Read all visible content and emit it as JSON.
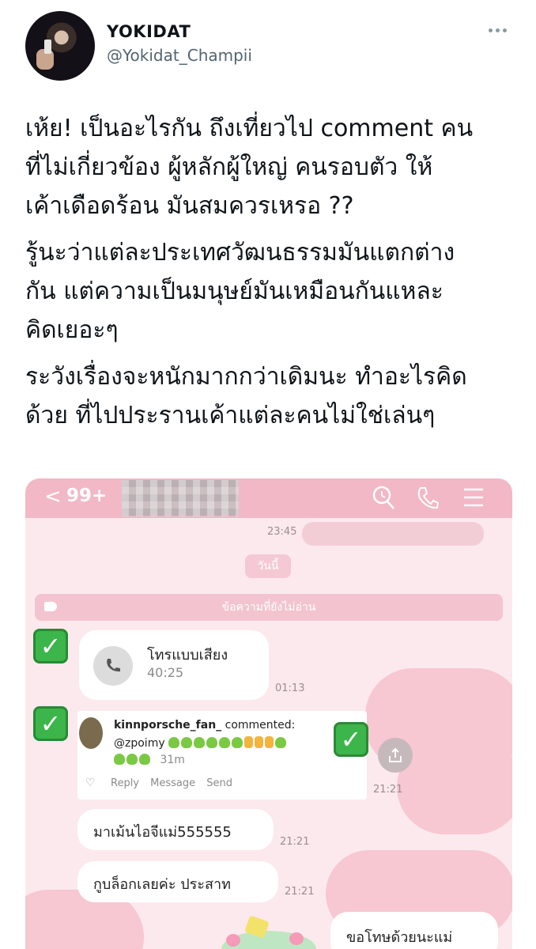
{
  "tweet": {
    "display_name": "YOKIDAT",
    "handle": "@Yokidat_Champii",
    "paragraphs": [
      [
        "เห้ย! เป็นอะไรกัน ถึงเที่ยวไป comment คน",
        "ที่ไม่เกี่ยวข้อง ผู้หลักผู้ใหญ่ คนรอบตัว ให้",
        "เค้าเดือดร้อน มันสมควรเหรอ ??"
      ],
      [
        "รู้นะว่าแต่ละประเทศวัฒนธรรมมันแตกต่าง",
        "กัน แต่ความเป็นมนุษย์มันเหมือนกันแหละ",
        "คิดเยอะๆ"
      ],
      [
        "ระวังเรื่องจะหนักมากกว่าเดิมนะ ทำอะไรคิด",
        "ด้วย ที่ไปประรานเค้าแต่ละคนไม่ใช่เล่นๆ"
      ]
    ]
  },
  "chat": {
    "back_glyph": "<",
    "unread_count": "99+",
    "prev_time": "23:45",
    "date_chip": "วันนี้",
    "unread_banner": "ข้อความที่ยังไม่อ่าน",
    "call": {
      "title": "โทรแบบเสียง",
      "duration": "40:25",
      "time": "01:13"
    },
    "instagram": {
      "username": "kinnporsche_fan_",
      "action": "commented:",
      "mention": "@zpoimy",
      "age": "31m",
      "actions": [
        "Reply",
        "Message",
        "Send"
      ],
      "time": "21:21"
    },
    "messages": [
      {
        "text": "มาเม้นไอจีแม่555555",
        "time": "21:21"
      },
      {
        "text": "กูบล็อกเลยค่ะ ประสาท",
        "time": "21:21"
      },
      {
        "text": "ขอโทษด้วยนะแม่",
        "time": ""
      }
    ]
  },
  "colors": {
    "chat_bg": "#fbe9ee",
    "chat_topbar": "#f2b8c6",
    "check_green": "#3cb54a",
    "handle_gray": "#536471"
  },
  "icons": [
    "more-icon",
    "back-icon",
    "search-icon",
    "phone-icon",
    "menu-icon",
    "check-icon",
    "share-icon",
    "heart-icon"
  ]
}
